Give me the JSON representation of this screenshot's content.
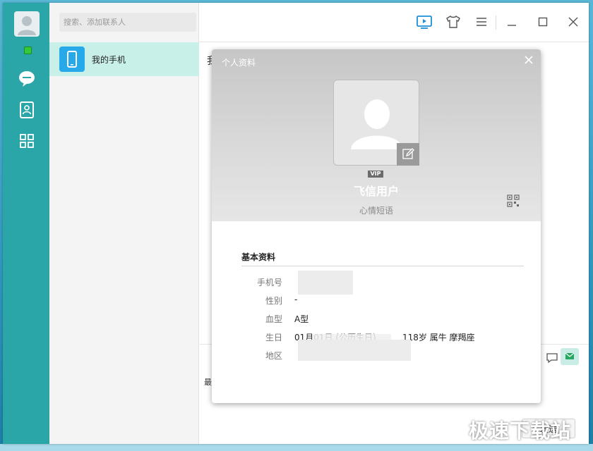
{
  "search": {
    "placeholder": "搜索、添加联系人"
  },
  "contacts": [
    {
      "label": "我的手机"
    }
  ],
  "chat": {
    "title": "我",
    "hint": "最",
    "send_label": "发送"
  },
  "profile_card": {
    "title": "个人资料",
    "vip_badge": "VIP",
    "user_name": "飞信用户",
    "mood": "心情短语",
    "section_title": "基本资料",
    "fields": [
      {
        "key": "手机号",
        "value": ""
      },
      {
        "key": "性别",
        "value": "-"
      },
      {
        "key": "血型",
        "value": "A型"
      },
      {
        "key": "生日",
        "value": "01月01日 (公历生日)",
        "extra": "118岁  属牛  摩羯座"
      },
      {
        "key": "地区",
        "value": ""
      }
    ]
  },
  "watermark": {
    "text": "极速下载站"
  },
  "colors": {
    "rail": "#2aa5a8",
    "accent": "#27a8e8",
    "selected": "#c8efe8"
  }
}
